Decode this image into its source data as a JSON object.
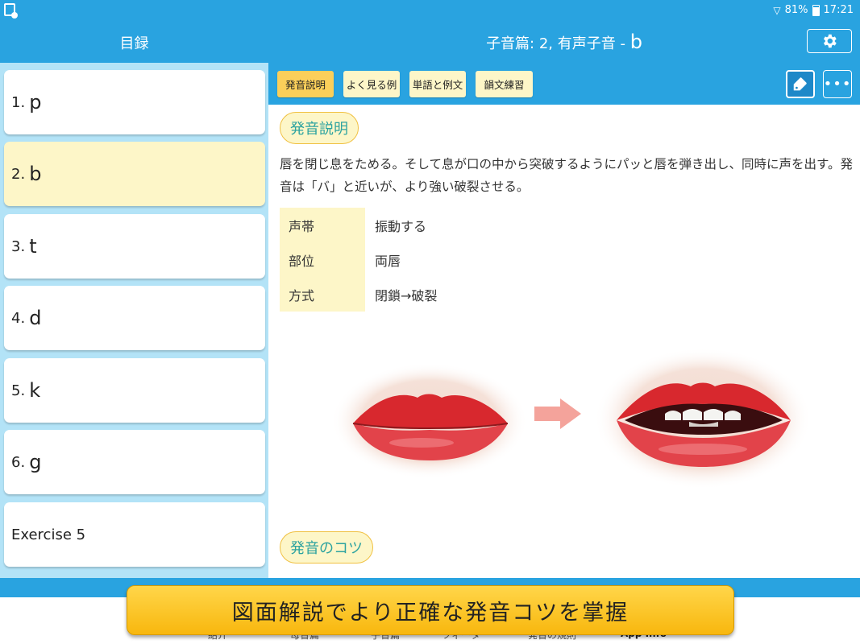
{
  "status_bar": {
    "battery": "81%",
    "time": "17:21"
  },
  "header": {
    "sidebar_title": "目録",
    "title_prefix": "子音篇: 2,  有声子音 - ",
    "title_letter": "b"
  },
  "sidebar": {
    "items": [
      {
        "num": "1.",
        "sym": "p"
      },
      {
        "num": "2.",
        "sym": "b"
      },
      {
        "num": "3.",
        "sym": "t"
      },
      {
        "num": "4.",
        "sym": "d"
      },
      {
        "num": "5.",
        "sym": "k"
      },
      {
        "num": "6.",
        "sym": "g"
      },
      {
        "label": "Exercise 5"
      }
    ],
    "active_index": 1
  },
  "toolbar": {
    "tabs": [
      "発音説明",
      "よく見る例",
      "単語と例文",
      "韻文練習"
    ],
    "active_tab": 0
  },
  "content": {
    "section1_title": "発音説明",
    "description": "唇を閉じ息をためる。そして息が口の中から突破するようにパッと唇を弾き出し、同時に声を出す。発音は「バ」と近いが、より強い破裂させる。",
    "properties": [
      {
        "key": "声帯",
        "value": "振動する"
      },
      {
        "key": "部位",
        "value": "両唇"
      },
      {
        "key": "方式",
        "value": "閉鎖→破裂"
      }
    ],
    "section2_title": "発音のコツ"
  },
  "bottom_nav": {
    "items": [
      "紹介",
      "母音篇",
      "子音篇",
      "ツィータ",
      "発音の規則",
      "App Info"
    ]
  },
  "banner": {
    "text": "図面解説でより正確な発音コツを掌握"
  },
  "colors": {
    "primary": "#29a3e0",
    "sidebar_bg": "#b3e3f7",
    "highlight": "#fdf6c8",
    "active_tab": "#fbcf5a",
    "teal_text": "#2da3a0",
    "banner": "#ffc928"
  },
  "icons": {
    "settings": "gear-icon",
    "tag": "tag-icon",
    "more": "more-icon",
    "arrow": "arrow-right-icon"
  }
}
